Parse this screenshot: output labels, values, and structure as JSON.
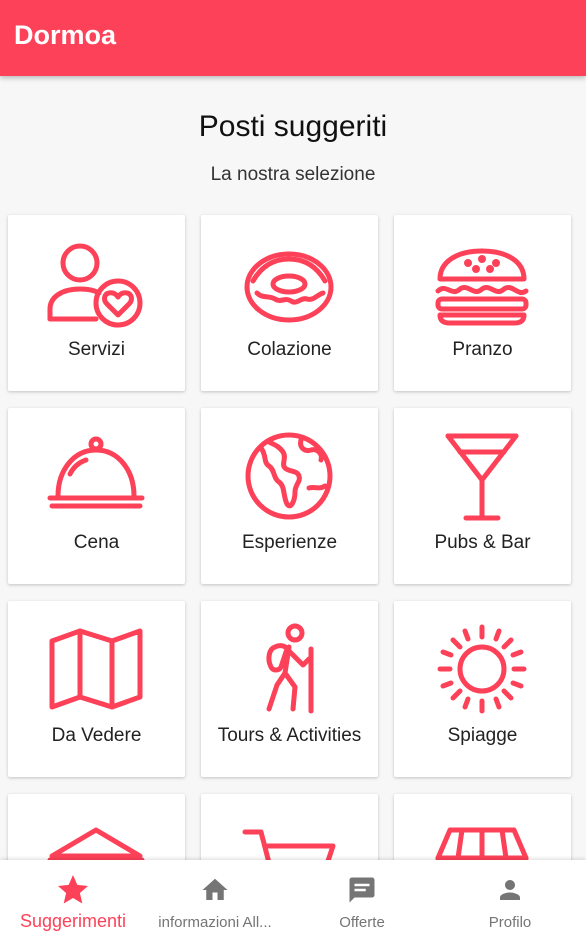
{
  "app": {
    "title": "Dormoa"
  },
  "header": {
    "title": "Posti suggeriti",
    "subtitle": "La nostra selezione"
  },
  "categories": [
    {
      "label": "Servizi",
      "icon": "user-heart-icon"
    },
    {
      "label": "Colazione",
      "icon": "donut-icon"
    },
    {
      "label": "Pranzo",
      "icon": "burger-icon"
    },
    {
      "label": "Cena",
      "icon": "cloche-icon"
    },
    {
      "label": "Esperienze",
      "icon": "globe-icon"
    },
    {
      "label": "Pubs & Bar",
      "icon": "cocktail-icon"
    },
    {
      "label": "Da Vedere",
      "icon": "map-icon"
    },
    {
      "label": "Tours & Activities",
      "icon": "hiker-icon"
    },
    {
      "label": "Spiagge",
      "icon": "sun-icon"
    },
    {
      "label": "",
      "icon": "museum-icon"
    },
    {
      "label": "",
      "icon": "cart-icon"
    },
    {
      "label": "",
      "icon": "shop-awning-icon"
    }
  ],
  "bottom_nav": [
    {
      "label": "Suggerimenti",
      "icon": "star-icon",
      "active": true
    },
    {
      "label": "informazioni All...",
      "icon": "home-icon",
      "active": false
    },
    {
      "label": "Offerte",
      "icon": "chat-icon",
      "active": false
    },
    {
      "label": "Profilo",
      "icon": "person-icon",
      "active": false
    }
  ],
  "colors": {
    "accent": "#fd4158",
    "icon_gray": "#757575"
  }
}
